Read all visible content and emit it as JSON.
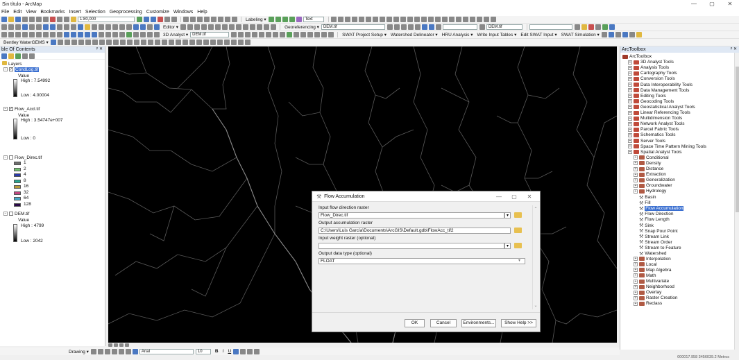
{
  "window": {
    "title": "Sin título - ArcMap",
    "minimize": "—",
    "maximize": "▢",
    "close": "✕"
  },
  "menu": [
    "File",
    "Edit",
    "View",
    "Bookmarks",
    "Insert",
    "Selection",
    "Geoprocessing",
    "Customize",
    "Windows",
    "Help"
  ],
  "toolbar1": {
    "scale": "1:80,000",
    "labeling": "Labeling ▾",
    "font": "Text"
  },
  "toolbar2": {
    "editor": "Editor ▾",
    "georef": "Georeferencing ▾",
    "georef_layer": "DEM.tif",
    "layer_combo": "DEM.tif"
  },
  "toolbar3": {
    "analyst": "3D Analyst ▾",
    "analyst_layer": "DEM.tif",
    "swat_items": [
      "SWAT Project Setup ▾",
      "Watershed Delineator ▾",
      "HRU Analysis ▾",
      "Write Input Tables ▾",
      "Edit SWAT Input ▾",
      "SWAT Simulation ▾"
    ]
  },
  "toolbar4": {
    "bentley": "Bentley WaterGEMS ▾"
  },
  "toc": {
    "title": "ble Of Contents",
    "pin": "ᵖ ✕",
    "layers_label": "Layers",
    "value_word": "Value",
    "layers": [
      {
        "name": "CondLog.tif",
        "high": "High : 7.54992",
        "low": "Low : 4.00004"
      },
      {
        "name": "Flow_Accl.tif",
        "high": "High : 3.54747e+007",
        "low": "Low : 0"
      },
      {
        "name": "Flow_Direc.tif",
        "classes": [
          "1",
          "2",
          "4",
          "8",
          "16",
          "32",
          "64",
          "128"
        ]
      },
      {
        "name": "DEM.tif",
        "high": "High : 4799",
        "low": "Low : 2042"
      }
    ]
  },
  "direction_colors": [
    "#6e6e6e",
    "#70c070",
    "#2a3aa8",
    "#2aa890",
    "#b89a3a",
    "#c04880",
    "#48a8c8",
    "#2a0a48"
  ],
  "arctoolbox": {
    "title": "ArcToolbox",
    "pin": "ᵖ ✕",
    "root": "ArcToolbox",
    "toolboxes": [
      "3D Analyst Tools",
      "Analysis Tools",
      "Cartography Tools",
      "Conversion Tools",
      "Data Interoperability Tools",
      "Data Management Tools",
      "Editing Tools",
      "Geocoding Tools",
      "Geostatistical Analyst Tools",
      "Linear Referencing Tools",
      "Multidimension Tools",
      "Network Analyst Tools",
      "Parcel Fabric Tools",
      "Schematics Tools",
      "Server Tools",
      "Space Time Pattern Mining Tools",
      "Spatial Analyst Tools"
    ],
    "spatial_toolsets_a": [
      "Conditional",
      "Density",
      "Distance",
      "Extraction",
      "Generalization",
      "Groundwater",
      "Hydrology"
    ],
    "hydrology_tools": [
      "Basin",
      "Fill",
      "Flow Accumulation",
      "Flow Direction",
      "Flow Length",
      "Sink",
      "Snap Pour Point",
      "Stream Link",
      "Stream Order",
      "Stream to Feature",
      "Watershed"
    ],
    "spatial_toolsets_b": [
      "Interpolation",
      "Local",
      "Map Algebra",
      "Math",
      "Multivariate",
      "Neighborhood",
      "Overlay",
      "Raster Creation",
      "Reclass"
    ]
  },
  "dialog": {
    "title": "Flow Accumulation",
    "input_dir_label": "Input flow direction raster",
    "input_dir_value": "Flow_Direc.tif",
    "output_label": "Output accumulation raster",
    "output_value": "C:\\Users\\Luis García\\Documents\\ArcGIS\\Default.gdb\\FlowAcc_tif2",
    "weight_label": "Input weight raster (optional)",
    "weight_value": "",
    "dtype_label": "Output data type (optional)",
    "dtype_value": "FLOAT",
    "ok": "OK",
    "cancel": "Cancel",
    "env": "Environments...",
    "help": "Show Help >>"
  },
  "drawing": {
    "label": "Drawing ▾",
    "font": "Arial",
    "size": "10",
    "bold": "B",
    "italic": "I",
    "underline": "U"
  },
  "status": "000017.958  3456039.2 Metros"
}
